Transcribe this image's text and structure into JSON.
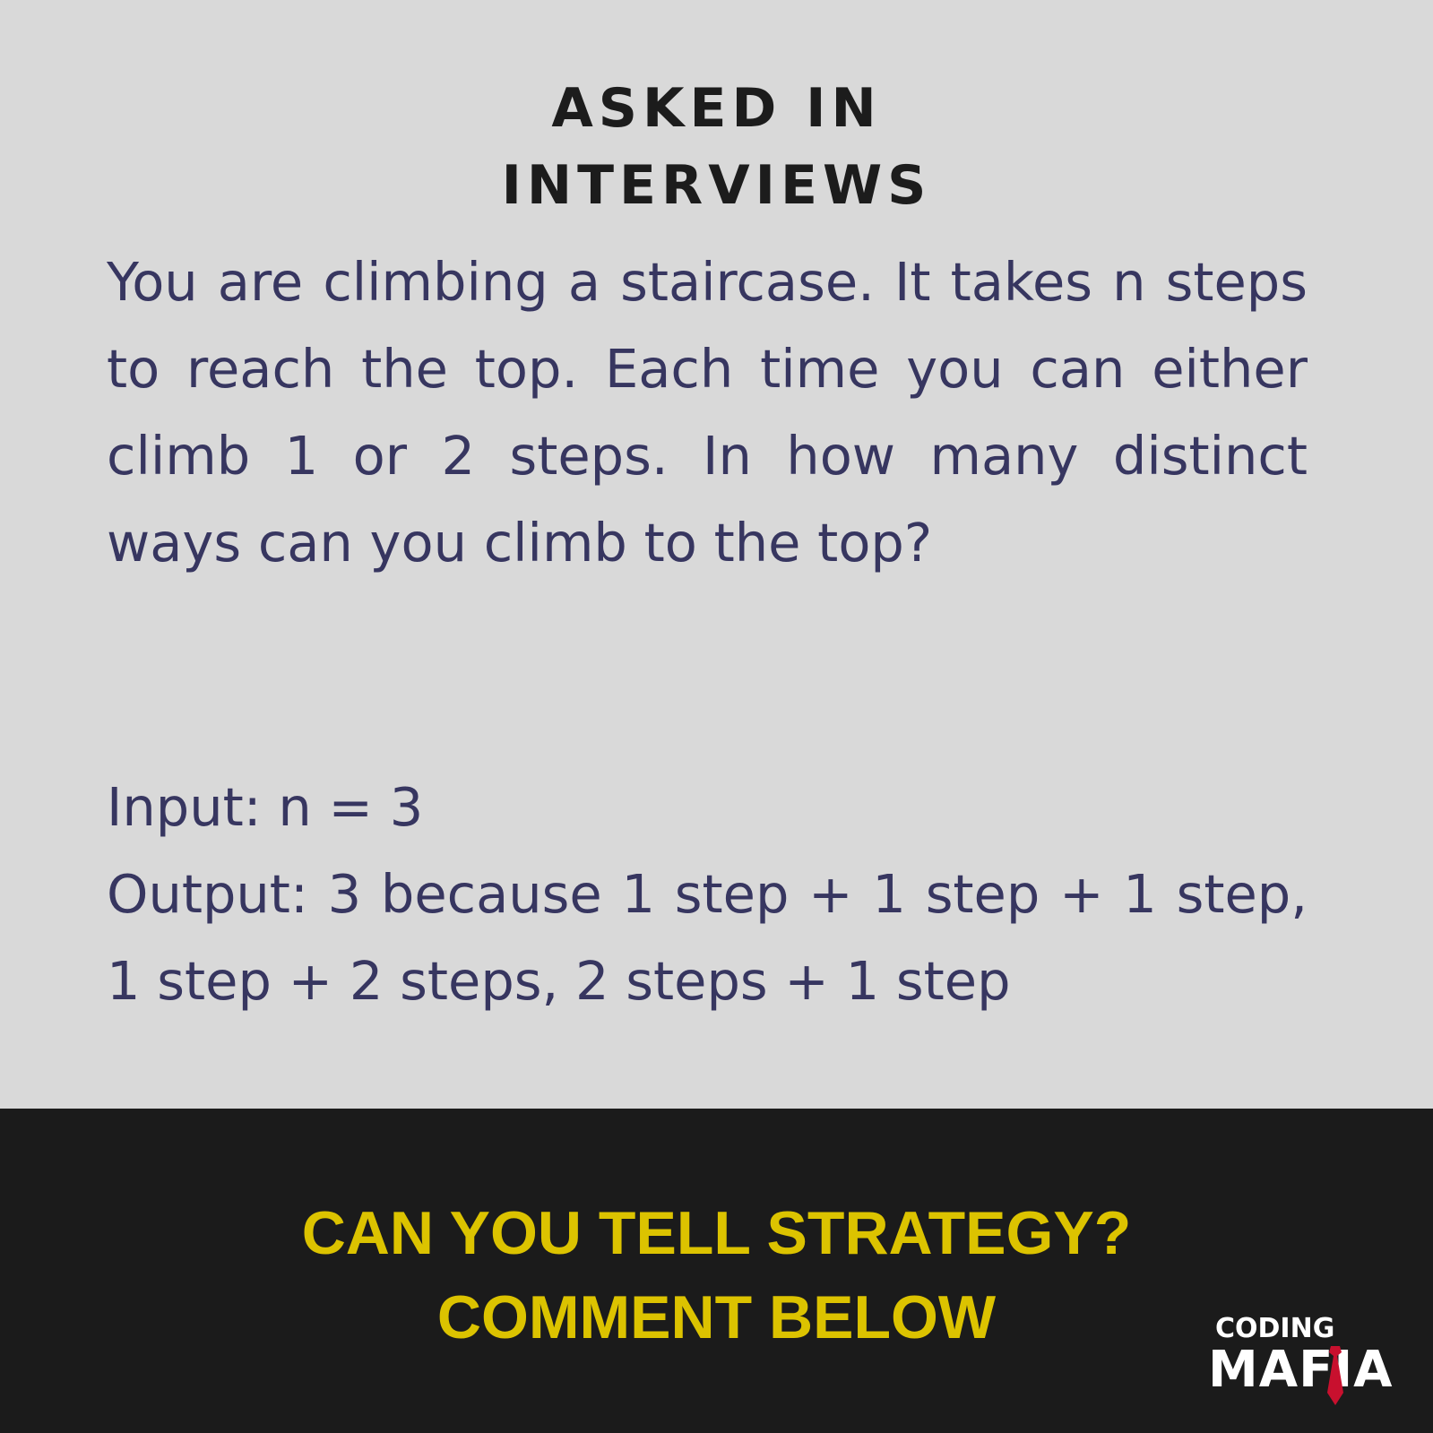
{
  "header": {
    "line1": "ASKED IN",
    "line2": "INTERVIEWS"
  },
  "problem": {
    "text": "You are climbing a staircase. It takes n steps to reach the top. Each time you can either climb 1 or 2 steps. In how many distinct ways can you climb to the top?"
  },
  "example": {
    "input": "Input: n = 3",
    "output": "Output: 3 because 1 step + 1 step + 1 step, 1 step + 2 steps, 2 steps + 1 step"
  },
  "cta": {
    "line1": "CAN YOU TELL STRATEGY?",
    "line2": "COMMENT BELOW"
  },
  "logo": {
    "top": "CODING",
    "bottom": "MAFIA"
  },
  "colors": {
    "top_background": "#d9d9d9",
    "bottom_background": "#1b1b1b",
    "header_text": "#1c1c1c",
    "body_text": "#373660",
    "cta_text": "#dcc300",
    "logo_text": "#ffffff",
    "logo_tie": "#c8102e"
  }
}
